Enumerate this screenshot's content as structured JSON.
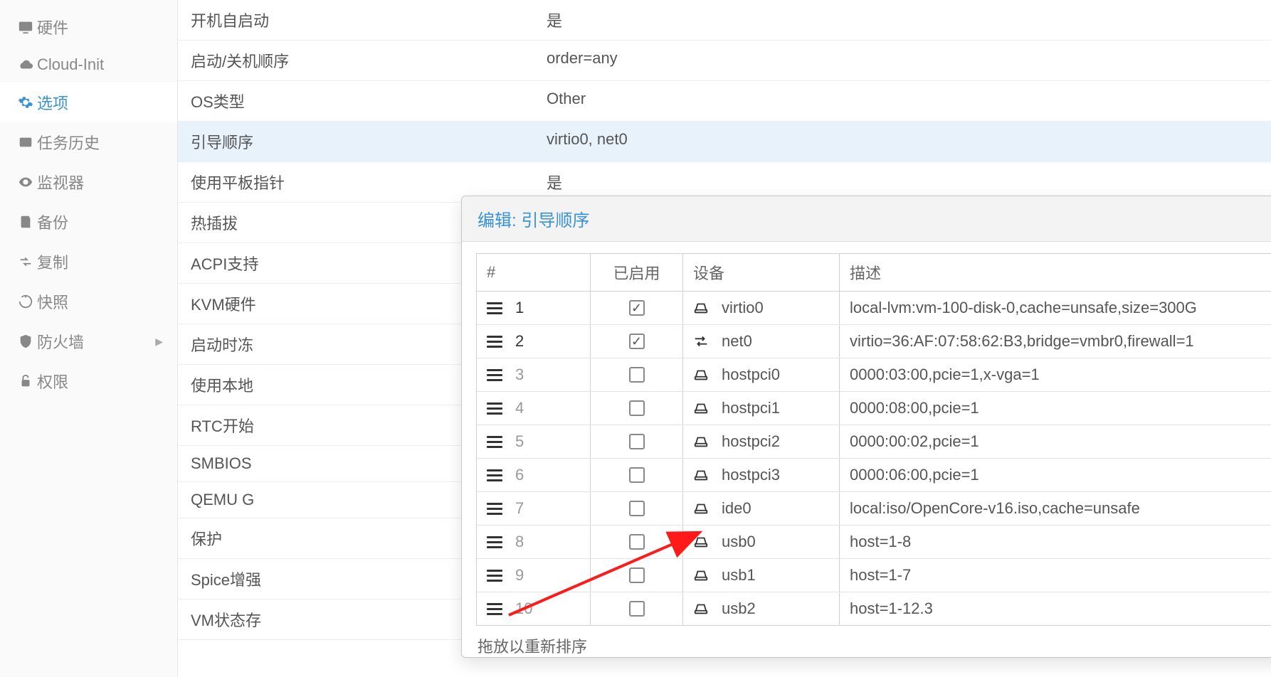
{
  "sidebar": {
    "items": [
      {
        "id": "hardware",
        "label": "硬件"
      },
      {
        "id": "cloudinit",
        "label": "Cloud-Init"
      },
      {
        "id": "options",
        "label": "选项"
      },
      {
        "id": "taskhistory",
        "label": "任务历史"
      },
      {
        "id": "monitor",
        "label": "监视器"
      },
      {
        "id": "backup",
        "label": "备份"
      },
      {
        "id": "replication",
        "label": "复制"
      },
      {
        "id": "snapshots",
        "label": "快照"
      },
      {
        "id": "firewall",
        "label": "防火墙"
      },
      {
        "id": "permissions",
        "label": "权限"
      }
    ]
  },
  "options": {
    "rows": [
      {
        "k": "开机自启动",
        "v": "是"
      },
      {
        "k": "启动/关机顺序",
        "v": "order=any"
      },
      {
        "k": "OS类型",
        "v": "Other"
      },
      {
        "k": "引导顺序",
        "v": "virtio0, net0"
      },
      {
        "k": "使用平板指针",
        "v": "是"
      },
      {
        "k": "热插拔",
        "v": ""
      },
      {
        "k": "ACPI支持",
        "v": ""
      },
      {
        "k": "KVM硬件",
        "v": ""
      },
      {
        "k": "启动时冻",
        "v": ""
      },
      {
        "k": "使用本地",
        "v": ""
      },
      {
        "k": "RTC开始",
        "v": ""
      },
      {
        "k": "SMBIOS",
        "v": ""
      },
      {
        "k": "QEMU G",
        "v": ""
      },
      {
        "k": "保护",
        "v": ""
      },
      {
        "k": "Spice增强",
        "v": ""
      },
      {
        "k": "VM状态存",
        "v": ""
      }
    ],
    "selected_index": 3
  },
  "modal": {
    "title": "编辑: 引导顺序",
    "columns": {
      "num": "#",
      "enabled": "已启用",
      "device": "设备",
      "desc": "描述"
    },
    "rows": [
      {
        "n": "1",
        "enabled": true,
        "type": "disk",
        "dev": "virtio0",
        "desc": "local-lvm:vm-100-disk-0,cache=unsafe,size=300G"
      },
      {
        "n": "2",
        "enabled": true,
        "type": "net",
        "dev": "net0",
        "desc": "virtio=36:AF:07:58:62:B3,bridge=vmbr0,firewall=1"
      },
      {
        "n": "3",
        "enabled": false,
        "type": "disk",
        "dev": "hostpci0",
        "desc": "0000:03:00,pcie=1,x-vga=1"
      },
      {
        "n": "4",
        "enabled": false,
        "type": "disk",
        "dev": "hostpci1",
        "desc": "0000:08:00,pcie=1"
      },
      {
        "n": "5",
        "enabled": false,
        "type": "disk",
        "dev": "hostpci2",
        "desc": "0000:00:02,pcie=1"
      },
      {
        "n": "6",
        "enabled": false,
        "type": "disk",
        "dev": "hostpci3",
        "desc": "0000:06:00,pcie=1"
      },
      {
        "n": "7",
        "enabled": false,
        "type": "disk",
        "dev": "ide0",
        "desc": "local:iso/OpenCore-v16.iso,cache=unsafe"
      },
      {
        "n": "8",
        "enabled": false,
        "type": "disk",
        "dev": "usb0",
        "desc": "host=1-8"
      },
      {
        "n": "9",
        "enabled": false,
        "type": "disk",
        "dev": "usb1",
        "desc": "host=1-7"
      },
      {
        "n": "10",
        "enabled": false,
        "type": "disk",
        "dev": "usb2",
        "desc": "host=1-12.3"
      }
    ],
    "hint": "拖放以重新排序"
  }
}
